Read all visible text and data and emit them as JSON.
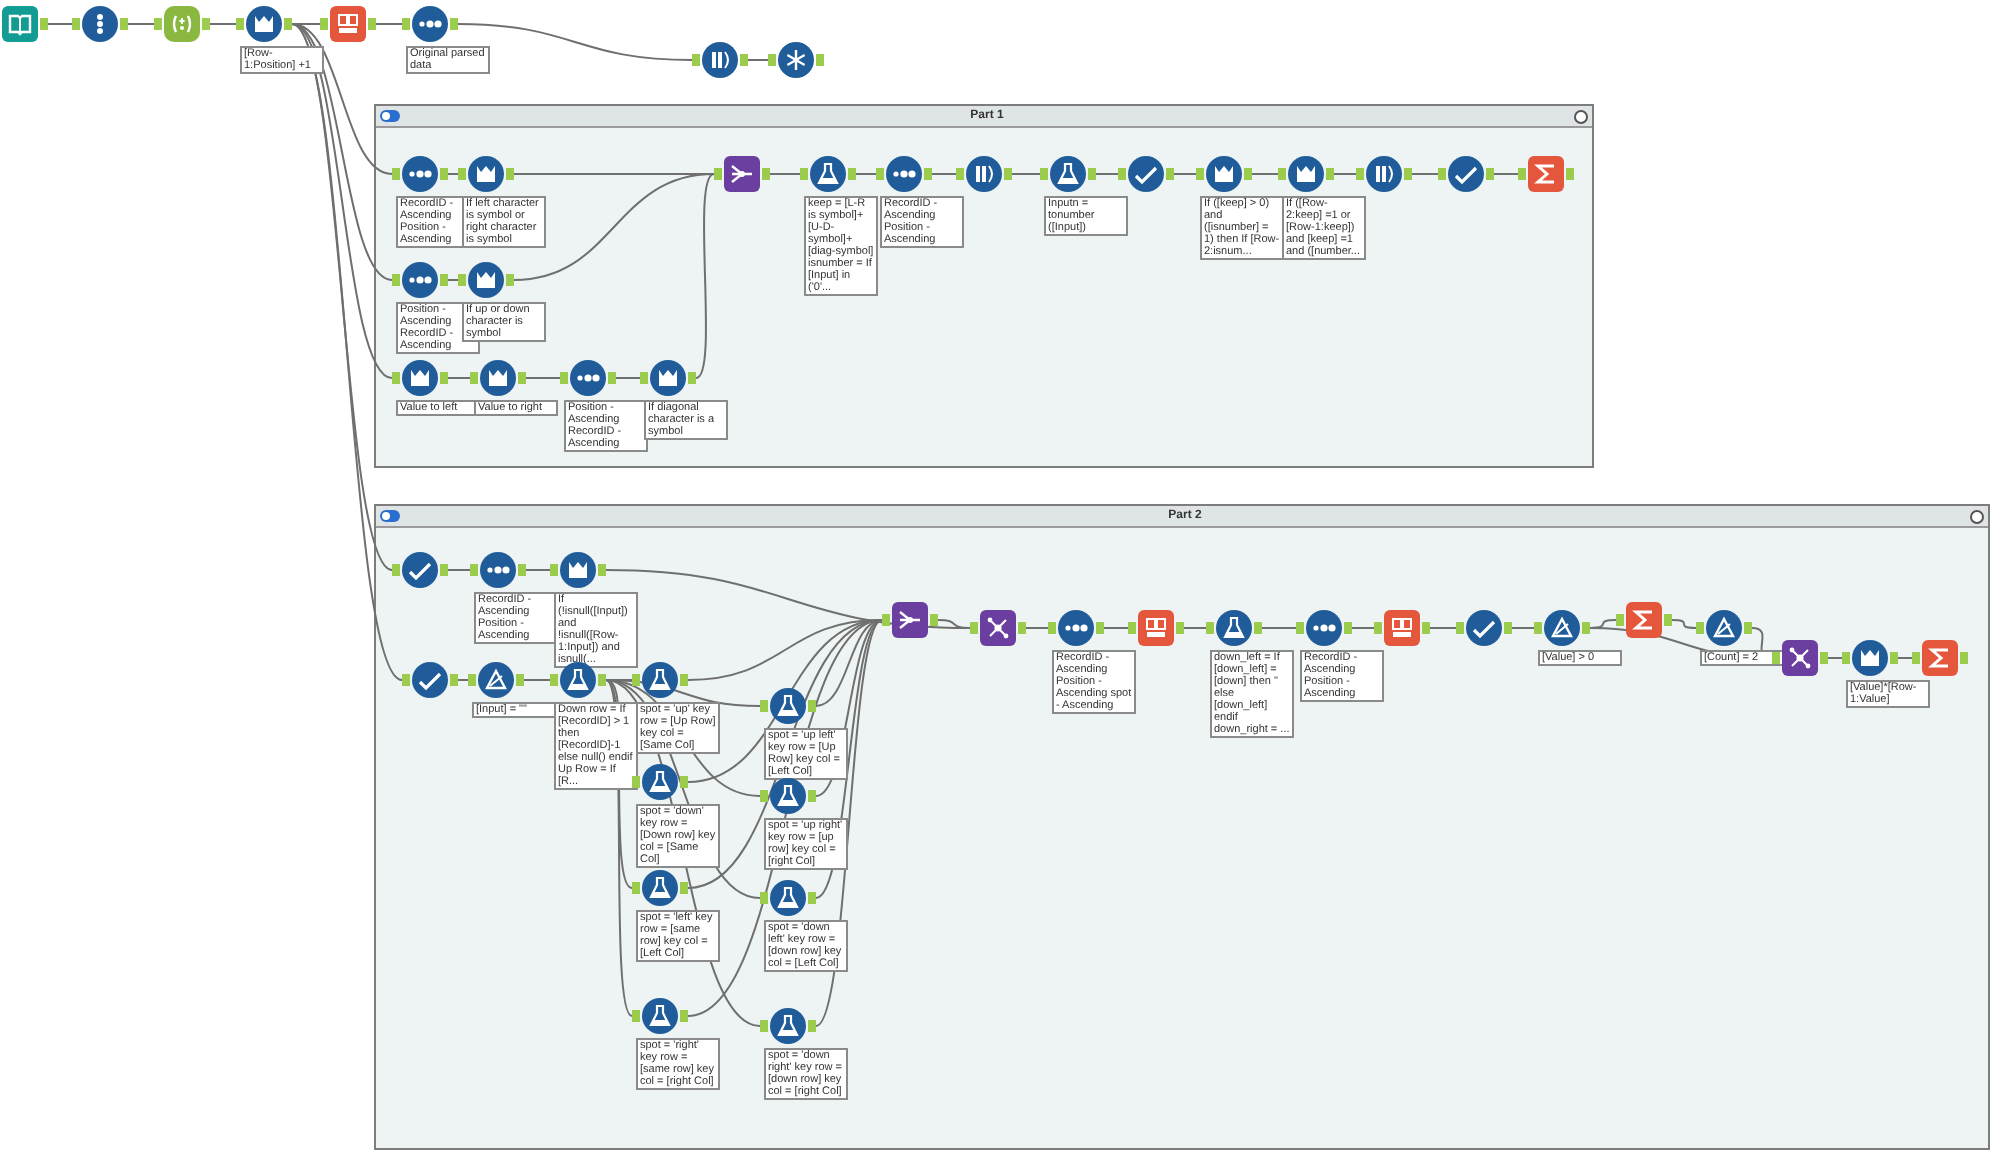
{
  "workflow": {
    "tools": [
      {
        "kind": "input"
      },
      {
        "kind": "select"
      },
      {
        "kind": "regex"
      },
      {
        "kind": "multirow",
        "annotation": "[Row-1:Position] +1"
      },
      {
        "kind": "textcol"
      },
      {
        "kind": "sort",
        "annotation": "Original parsed data"
      },
      {
        "kind": "selectbars"
      },
      {
        "kind": "snowflake"
      }
    ]
  },
  "containers": [
    {
      "title": "Part 1",
      "expanded": true,
      "tools": [
        {
          "kind": "sort",
          "annotation": "RecordID - Ascending Position - Ascending"
        },
        {
          "kind": "multirow",
          "annotation": "If left character is symbol or right character is symbol"
        },
        {
          "kind": "union"
        },
        {
          "kind": "formula",
          "annotation": "keep = [L-R is symbol]+[U-D-symbol]+[diag-symbol] isnumber = If [Input] in ('0'..."
        },
        {
          "kind": "sort",
          "annotation": "RecordID - Ascending Position - Ascending"
        },
        {
          "kind": "selectbars"
        },
        {
          "kind": "formula",
          "annotation": "Inputn = tonumber ([Input])"
        },
        {
          "kind": "filter"
        },
        {
          "kind": "multirow",
          "annotation": "If ([keep] > 0) and ([isnumber] = 1) then If [Row-2:isnum..."
        },
        {
          "kind": "multirow",
          "annotation": "If ([Row-2:keep] =1 or [Row-1:keep]) and [keep] =1 and ([number..."
        },
        {
          "kind": "selectbars"
        },
        {
          "kind": "filter"
        },
        {
          "kind": "summarize"
        },
        {
          "kind": "sort",
          "annotation": "Position - Ascending RecordID - Ascending"
        },
        {
          "kind": "multirow",
          "annotation": "If up or down character is symbol"
        },
        {
          "kind": "multirow",
          "annotation": "Value to left"
        },
        {
          "kind": "multirow",
          "annotation": "Value to right"
        },
        {
          "kind": "sort",
          "annotation": "Position - Ascending RecordID - Ascending"
        },
        {
          "kind": "multirow",
          "annotation": "If diagonal character is a symbol"
        }
      ]
    },
    {
      "title": "Part 2",
      "expanded": true,
      "tools": [
        {
          "kind": "filter"
        },
        {
          "kind": "sort",
          "annotation": "RecordID - Ascending Position - Ascending"
        },
        {
          "kind": "multirow",
          "annotation": "If (!isnull([Input]) and !isnull([Row-1:Input]) and isnull(..."
        },
        {
          "kind": "filter"
        },
        {
          "kind": "filtertri",
          "annotation": "[Input] = \"\""
        },
        {
          "kind": "formula",
          "annotation": "Down row = If [RecordID] > 1 then [RecordID]-1 else null() endif Up Row = If [R..."
        },
        {
          "kind": "formula",
          "annotation": "spot = 'up' key row = [Up Row] key col = [Same Col]"
        },
        {
          "kind": "formula",
          "annotation": "spot = 'up left' key row = [Up Row] key col = [Left Col]"
        },
        {
          "kind": "formula",
          "annotation": "spot = 'down' key row = [Down row] key col = [Same Col]"
        },
        {
          "kind": "formula",
          "annotation": "spot = 'up right' key row = [up row] key col = [right Col]"
        },
        {
          "kind": "formula",
          "annotation": "spot = 'left' key row = [same row] key col = [Left Col]"
        },
        {
          "kind": "formula",
          "annotation": "spot = 'down left' key row = [down row] key col = [Left Col]"
        },
        {
          "kind": "formula",
          "annotation": "spot = 'right' key row = [same row] key col = [right Col]"
        },
        {
          "kind": "formula",
          "annotation": "spot = 'down right' key row = [down row] key col = [right Col]"
        },
        {
          "kind": "union"
        },
        {
          "kind": "join"
        },
        {
          "kind": "sort",
          "annotation": "RecordID - Ascending Position - Ascending spot - Ascending"
        },
        {
          "kind": "textcol"
        },
        {
          "kind": "formula",
          "annotation": "down_left = If [down_left] = [down] then '' else [down_left] endif down_right = ..."
        },
        {
          "kind": "sort",
          "annotation": "RecordID - Ascending Position - Ascending"
        },
        {
          "kind": "crosstab"
        },
        {
          "kind": "filter"
        },
        {
          "kind": "filtertri",
          "annotation": "[Value] > 0"
        },
        {
          "kind": "summarize"
        },
        {
          "kind": "filtertri",
          "annotation": "[Count] = 2"
        },
        {
          "kind": "join"
        },
        {
          "kind": "multirow",
          "annotation": "[Value]*[Row-1:Value]"
        },
        {
          "kind": "summarize"
        }
      ]
    }
  ]
}
